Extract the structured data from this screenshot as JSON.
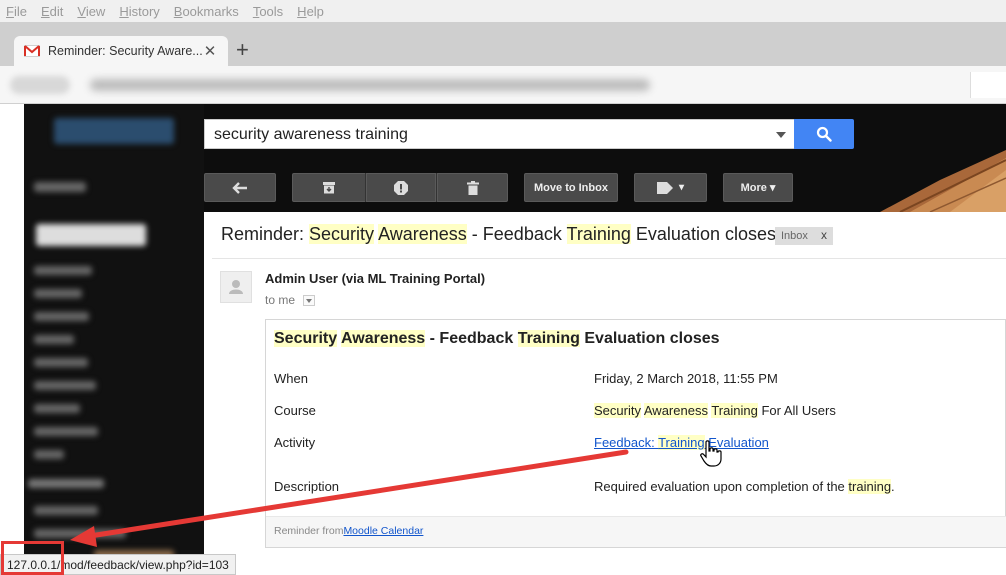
{
  "browser": {
    "menu": [
      "File",
      "Edit",
      "View",
      "History",
      "Bookmarks",
      "Tools",
      "Help"
    ],
    "tab_title": "Reminder: Security Aware...",
    "tab_close": "✕",
    "new_tab": "+"
  },
  "search": {
    "query": "security awareness training"
  },
  "toolbar": {
    "move_to_inbox": "Move to Inbox",
    "more": "More ▾",
    "labels_caret": "▾"
  },
  "email": {
    "subject_parts": [
      "Reminder: ",
      "Security",
      " ",
      "Awareness",
      " - Feedback ",
      "Training",
      " Evaluation closes"
    ],
    "inbox_label": "Inbox",
    "inbox_remove": "x",
    "sender": "Admin User (via ML Training Portal)",
    "to_me": "to me",
    "card": {
      "title_parts": [
        "Security",
        " ",
        "Awareness",
        " - Feedback ",
        "Training",
        " Evaluation closes"
      ],
      "when_label": "When",
      "when_value": "Friday, 2 March 2018, 11:55 PM",
      "course_label": "Course",
      "course_parts": [
        "Security",
        " ",
        "Awareness",
        " ",
        "Training",
        " For All Users"
      ],
      "activity_label": "Activity",
      "activity_parts": [
        "Feedback: ",
        "Training",
        " Evaluation"
      ],
      "description_label": "Description",
      "description_parts": [
        "Required evaluation upon completion of the ",
        "training",
        "."
      ],
      "footer_prefix": "Reminder from",
      "footer_link": "Moodle Calendar"
    }
  },
  "statusbar": {
    "url": "127.0.0.1/mod/feedback/view.php?id=103"
  },
  "colors": {
    "highlight": "#ffffc5",
    "link": "#1155cc",
    "annotation": "#e53935",
    "search_button": "#4285f4"
  }
}
